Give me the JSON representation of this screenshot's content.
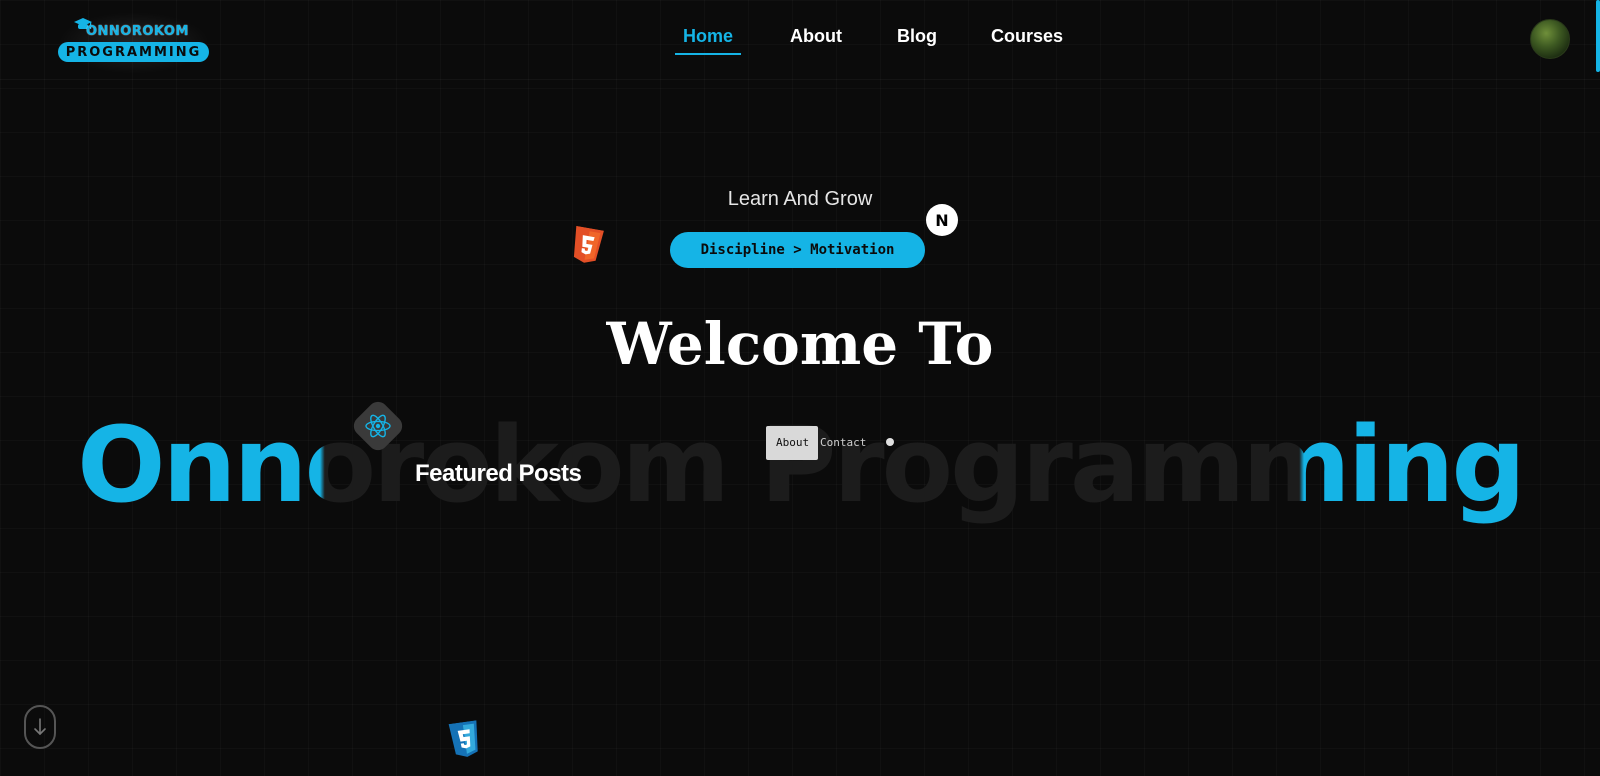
{
  "app": {
    "brand_top": "ONNOROKOM",
    "brand_bottom": "PROGRAMMING"
  },
  "nav": {
    "items": [
      {
        "label": "Home",
        "active": true
      },
      {
        "label": "About",
        "active": false
      },
      {
        "label": "Blog",
        "active": false
      },
      {
        "label": "Courses",
        "active": false
      }
    ]
  },
  "hero": {
    "tagline": "Learn And Grow",
    "pill": "Discipline > Motivation",
    "welcome": "Welcome To",
    "brand": "Onnorokom Programming"
  },
  "overlay": {
    "featured": "Featured Posts",
    "mini_about": "About",
    "mini_contact": "Contact"
  },
  "icons": {
    "html5": "html5-icon",
    "next": "N",
    "react": "react-icon",
    "css3": "css3-icon",
    "scroll": "arrow-down-icon"
  },
  "colors": {
    "accent": "#15b4e6",
    "background": "#0b0b0b"
  }
}
